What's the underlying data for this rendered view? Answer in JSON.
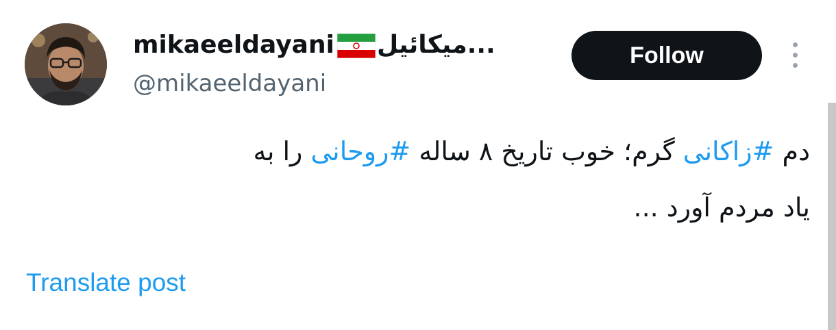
{
  "author": {
    "display_name_latin": "mikaeeldayani",
    "display_name_persian": "...میکائیل",
    "handle": "@mikaeeldayani",
    "flag": "iran-flag-icon"
  },
  "actions": {
    "follow_label": "Follow",
    "more_icon": "more-vertical-icon"
  },
  "post": {
    "line1": [
      {
        "text": "دم ",
        "hashtag": false
      },
      {
        "text": "#زاکانی",
        "hashtag": true
      },
      {
        "text": " گرم؛ خوب تاریخ ۸ ساله ",
        "hashtag": false
      },
      {
        "text": "#روحانی",
        "hashtag": true
      },
      {
        "text": " را به",
        "hashtag": false
      }
    ],
    "line2": "یاد مردم آورد ...",
    "translate_label": "Translate post"
  },
  "colors": {
    "link": "#1d9bf0",
    "text": "#0f1419",
    "secondary": "#536471",
    "button_bg": "#0f1419"
  }
}
